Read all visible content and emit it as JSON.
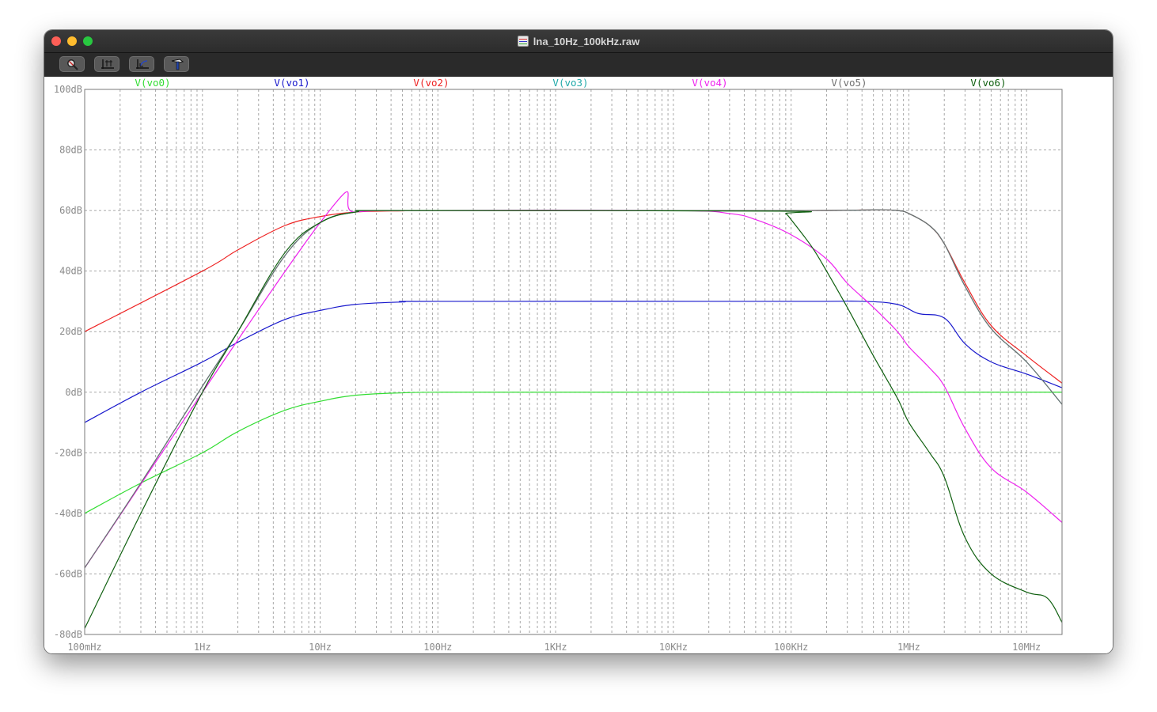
{
  "window": {
    "title": "lna_10Hz_100kHz.raw",
    "traffic_lights": [
      "close",
      "minimize",
      "maximize"
    ]
  },
  "toolbar": {
    "buttons": [
      {
        "name": "zoom-tool-button",
        "icon": "magnifier-icon"
      },
      {
        "name": "autorange-button",
        "icon": "axes-icon"
      },
      {
        "name": "zoom-back-button",
        "icon": "zoom-back-icon"
      },
      {
        "name": "pick-trace-button",
        "icon": "hammer-icon"
      }
    ]
  },
  "chart_data": {
    "type": "line",
    "title": "",
    "xlabel": "",
    "ylabel": "",
    "x_scale": "log",
    "xlim": [
      0.1,
      20000000
    ],
    "ylim": [
      -80,
      100
    ],
    "grid": true,
    "legend_placement": "top",
    "x_ticks": [
      {
        "value": 0.1,
        "label": "100mHz"
      },
      {
        "value": 1,
        "label": "1Hz"
      },
      {
        "value": 10,
        "label": "10Hz"
      },
      {
        "value": 100,
        "label": "100Hz"
      },
      {
        "value": 1000,
        "label": "1KHz"
      },
      {
        "value": 10000,
        "label": "10KHz"
      },
      {
        "value": 100000,
        "label": "100KHz"
      },
      {
        "value": 1000000,
        "label": "1MHz"
      },
      {
        "value": 10000000,
        "label": "10MHz"
      }
    ],
    "y_ticks": [
      {
        "value": 100,
        "label": "100dB"
      },
      {
        "value": 80,
        "label": "80dB"
      },
      {
        "value": 60,
        "label": "60dB"
      },
      {
        "value": 40,
        "label": "40dB"
      },
      {
        "value": 20,
        "label": "20dB"
      },
      {
        "value": 0,
        "label": "0dB"
      },
      {
        "value": -20,
        "label": "-20dB"
      },
      {
        "value": -40,
        "label": "-40dB"
      },
      {
        "value": -60,
        "label": "-60dB"
      },
      {
        "value": -80,
        "label": "-80dB"
      }
    ],
    "series": [
      {
        "name": "V(vo0)",
        "color": "#33dd33",
        "x": [
          0.1,
          0.3,
          1,
          2,
          5,
          10,
          20,
          50,
          100,
          1000,
          100000,
          1000000,
          20000000
        ],
        "y": [
          -40,
          -30,
          -20,
          -13,
          -6,
          -3,
          -1,
          -0.2,
          0,
          0,
          0,
          0,
          0
        ]
      },
      {
        "name": "V(vo1)",
        "color": "#1818cc",
        "x": [
          0.1,
          0.3,
          1,
          2,
          5,
          10,
          20,
          50,
          100,
          100000,
          400000,
          800000,
          1200000,
          2000000,
          3000000,
          5000000,
          10000000,
          20000000
        ],
        "y": [
          -10,
          0,
          10,
          16.5,
          24,
          27,
          29,
          29.8,
          30,
          30,
          30,
          29,
          26,
          24.5,
          16,
          10,
          6,
          1.5
        ]
      },
      {
        "name": "V(vo2)",
        "color": "#ee2222",
        "x": [
          0.1,
          1,
          2,
          5,
          10,
          20,
          50,
          100,
          100000,
          500000,
          800000,
          1000000,
          1500000,
          2000000,
          3000000,
          5000000,
          10000000,
          20000000
        ],
        "y": [
          20,
          40,
          47,
          55,
          58,
          59.5,
          59.9,
          60,
          60,
          60.2,
          60,
          59,
          55,
          49,
          36,
          22,
          12,
          3
        ]
      },
      {
        "name": "V(vo3)",
        "color": "#22aaaa",
        "x": [
          0.1,
          0.3,
          1,
          2,
          5,
          10,
          20,
          50,
          100000,
          500000,
          800000,
          1000000,
          1500000,
          2000000,
          3000000,
          5000000,
          10000000,
          20000000
        ],
        "y": [
          -58,
          -30,
          2,
          20,
          45,
          56,
          59.5,
          60,
          60,
          60.2,
          60,
          59,
          55,
          49,
          35,
          21,
          10,
          -4
        ]
      },
      {
        "name": "V(vo4)",
        "color": "#ee22ee",
        "x": [
          0.1,
          10,
          20,
          100,
          10000,
          30000,
          50000,
          100000,
          200000,
          300000,
          500000,
          800000,
          1000000,
          1500000,
          2000000,
          3000000,
          5000000,
          10000000,
          20000000
        ],
        "y": [
          -58,
          56,
          59.5,
          60,
          60,
          59,
          57,
          52,
          44,
          36,
          28,
          20,
          15,
          8,
          2,
          -12,
          -25,
          -33,
          -43
        ]
      },
      {
        "name": "V(vo5)",
        "color": "#707070",
        "x": [
          0.1,
          0.3,
          1,
          2,
          5,
          10,
          20,
          50,
          100000,
          500000,
          800000,
          1000000,
          1500000,
          2000000,
          3000000,
          5000000,
          10000000,
          20000000
        ],
        "y": [
          -58,
          -30,
          2,
          20,
          45,
          56,
          59.5,
          60,
          60,
          60.2,
          60,
          59,
          55,
          49,
          35,
          21,
          10,
          -4
        ]
      },
      {
        "name": "V(vo6)",
        "color": "#106010",
        "x": [
          0.1,
          0.3,
          1,
          2,
          5,
          10,
          20,
          50,
          80000,
          90000,
          100000,
          150000,
          200000,
          300000,
          500000,
          800000,
          1000000,
          1500000,
          2000000,
          3000000,
          5000000,
          10000000,
          15000000,
          20000000
        ],
        "y": [
          -78,
          -40,
          0,
          20,
          46,
          56,
          59.5,
          60,
          59.8,
          59,
          57,
          48,
          40,
          28,
          12,
          -2,
          -10,
          -20,
          -28,
          -48,
          -60,
          -66,
          -68,
          -76
        ]
      }
    ]
  }
}
